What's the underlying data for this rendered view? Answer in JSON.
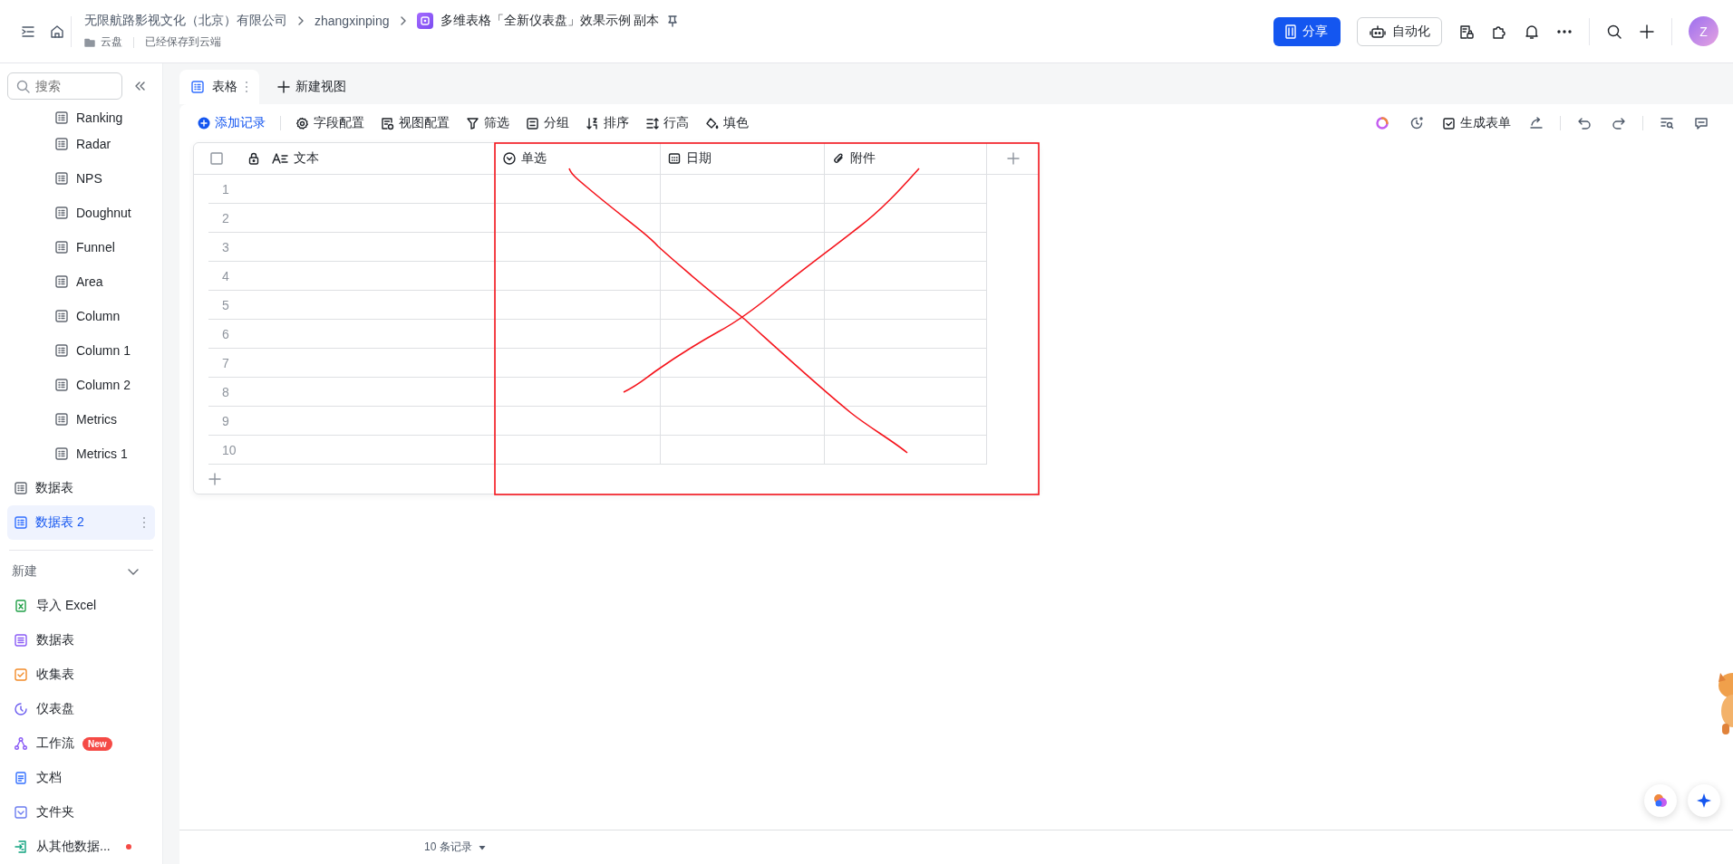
{
  "topbar": {
    "breadcrumb": [
      {
        "label": "无限航路影视文化（北京）有限公司",
        "kind": "org"
      },
      {
        "label": "zhangxinping",
        "kind": "user"
      },
      {
        "label": "多维表格「全新仪表盘」效果示例 副本",
        "kind": "doc"
      }
    ],
    "location": "云盘",
    "save_status": "已经保存到云端",
    "share_button": "分享",
    "automation_button": "自动化",
    "avatar": "Z"
  },
  "sidebar": {
    "search": {
      "placeholder": "搜索"
    },
    "sub_items": [
      {
        "label": "Ranking",
        "selected": false
      },
      {
        "label": "Radar",
        "selected": false
      },
      {
        "label": "NPS",
        "selected": false
      },
      {
        "label": "Doughnut",
        "selected": false
      },
      {
        "label": "Funnel",
        "selected": false
      },
      {
        "label": "Area",
        "selected": false
      },
      {
        "label": "Column",
        "selected": false
      },
      {
        "label": "Column 1",
        "selected": false
      },
      {
        "label": "Column 2",
        "selected": false
      },
      {
        "label": "Metrics",
        "selected": false
      },
      {
        "label": "Metrics 1",
        "selected": false
      }
    ],
    "items": [
      {
        "label": "数据表",
        "selected": false
      },
      {
        "label": "数据表 2",
        "selected": true
      }
    ],
    "new_section": {
      "title": "新建",
      "expanded": true,
      "items": [
        {
          "label": "导入 Excel",
          "kind": "excel"
        },
        {
          "label": "数据表",
          "kind": "table"
        },
        {
          "label": "收集表",
          "kind": "form"
        },
        {
          "label": "仪表盘",
          "kind": "dashboard"
        },
        {
          "label": "工作流",
          "kind": "workflow",
          "badge": "New"
        },
        {
          "label": "文档",
          "kind": "doc"
        },
        {
          "label": "文件夹",
          "kind": "folder"
        },
        {
          "label": "从其他数据...",
          "kind": "import",
          "notification": true
        }
      ]
    }
  },
  "view_tabs": [
    {
      "label": "表格",
      "selected": true
    }
  ],
  "new_view": "新建视图",
  "toolbar": {
    "left": [
      {
        "label": "添加记录",
        "kind": "add"
      },
      {
        "label": "字段配置",
        "kind": "gear"
      },
      {
        "label": "视图配置",
        "kind": "view"
      },
      {
        "label": "筛选",
        "kind": "filter"
      },
      {
        "label": "分组",
        "kind": "group"
      },
      {
        "label": "排序",
        "kind": "sort"
      },
      {
        "label": "行高",
        "kind": "height"
      },
      {
        "label": "填色",
        "kind": "fill"
      }
    ],
    "right": [
      {
        "label": "生成表单",
        "kind": "form"
      }
    ]
  },
  "table": {
    "select_all": {
      "checked": false
    },
    "columns": [
      {
        "name": "文本",
        "kind": "text",
        "locked": true
      },
      {
        "name": "单选",
        "kind": "select",
        "locked": false
      },
      {
        "name": "日期",
        "kind": "date",
        "locked": false
      },
      {
        "name": "附件",
        "kind": "attachment",
        "locked": false
      }
    ],
    "row_numbers": [
      "1",
      "2",
      "3",
      "4",
      "5",
      "6",
      "7",
      "8",
      "9",
      "10"
    ]
  },
  "footer": {
    "record_count": "10 条记录"
  }
}
